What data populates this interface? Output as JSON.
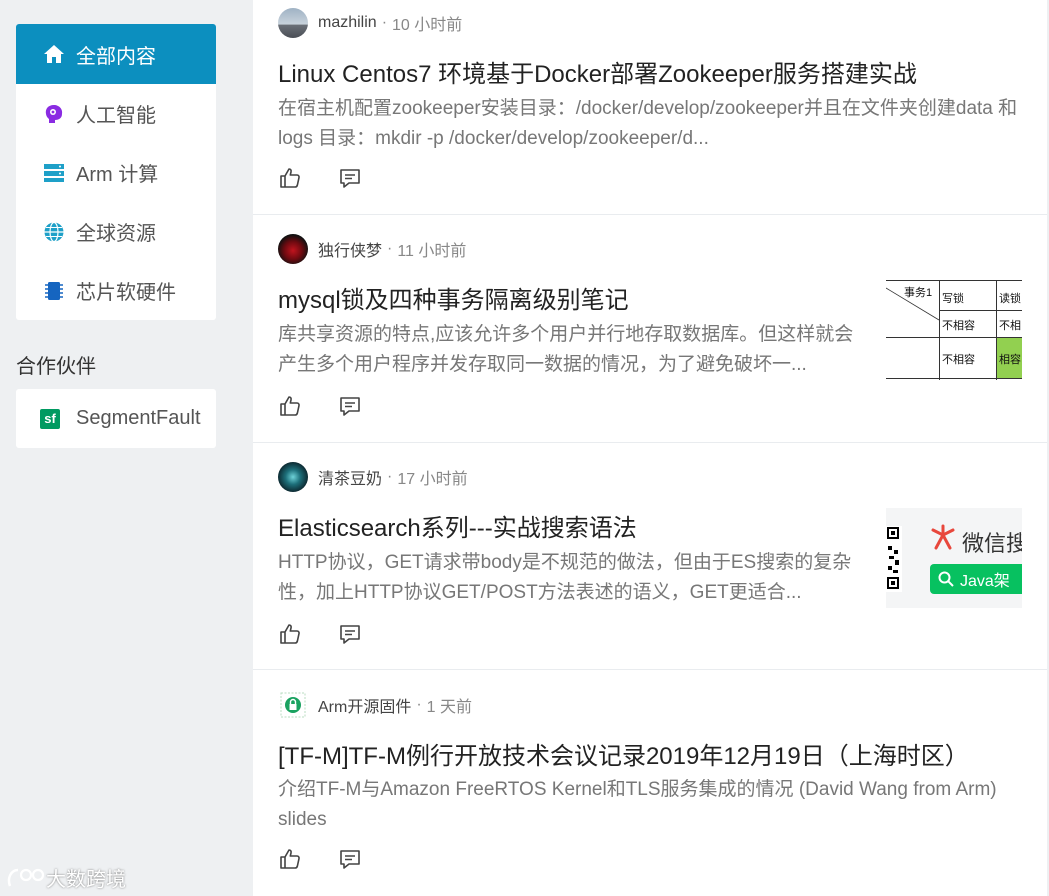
{
  "sidebar": {
    "items": [
      {
        "label": "全部内容",
        "icon": "home-icon",
        "active": true
      },
      {
        "label": "人工智能",
        "icon": "brain-icon"
      },
      {
        "label": "Arm 计算",
        "icon": "server-icon"
      },
      {
        "label": "全球资源",
        "icon": "globe-icon"
      },
      {
        "label": "芯片软硬件",
        "icon": "chip-icon"
      }
    ],
    "partners_title": "合作伙伴",
    "partner": {
      "label": "SegmentFault",
      "logo": "sf"
    }
  },
  "posts": [
    {
      "author": "mazhilin",
      "time": "10 小时前",
      "title": "Linux Centos7 环境基于Docker部署Zookeeper服务搭建实战",
      "excerpt": "在宿主机配置zookeeper安装目录：/docker/develop/zookeeper并且在文件夹创建data 和logs 目录：mkdir -p /docker/develop/zookeeper/d..."
    },
    {
      "author": "独行侠梦",
      "time": "11 小时前",
      "title": "mysql锁及四种事务隔离级别笔记",
      "excerpt": "库共享资源的特点,应该允许多个用户并行地存取数据库。但这样就会产生多个用户程序并发存取同一数据的情况，为了避免破坏一...",
      "thumb": {
        "header": "事务1",
        "c1": "写锁",
        "c2": "读锁",
        "r1": "不相容",
        "r1b": "不相",
        "r2": "不相容",
        "r2b": "相容"
      }
    },
    {
      "author": "清茶豆奶",
      "time": "17 小时前",
      "title": "Elasticsearch系列---实战搜索语法",
      "excerpt": "HTTP协议，GET请求带body是不规范的做法，但由于ES搜索的复杂性，加上HTTP协议GET/POST方法表述的语义，GET更适合...",
      "thumb": {
        "wechat": "微信搜",
        "search": "Java架"
      }
    },
    {
      "author": "Arm开源固件",
      "time": "1 天前",
      "title": "[TF-M]TF-M例行开放技术会议记录2019年12月19日（上海时区）",
      "excerpt": "介绍TF-M与Amazon FreeRTOS Kernel和TLS服务集成的情况 (David Wang from Arm) slides"
    }
  ],
  "watermark": "大数跨境",
  "colors": {
    "accent": "#0c8fbf",
    "sf": "#009a61",
    "wechat": "#07c160"
  }
}
